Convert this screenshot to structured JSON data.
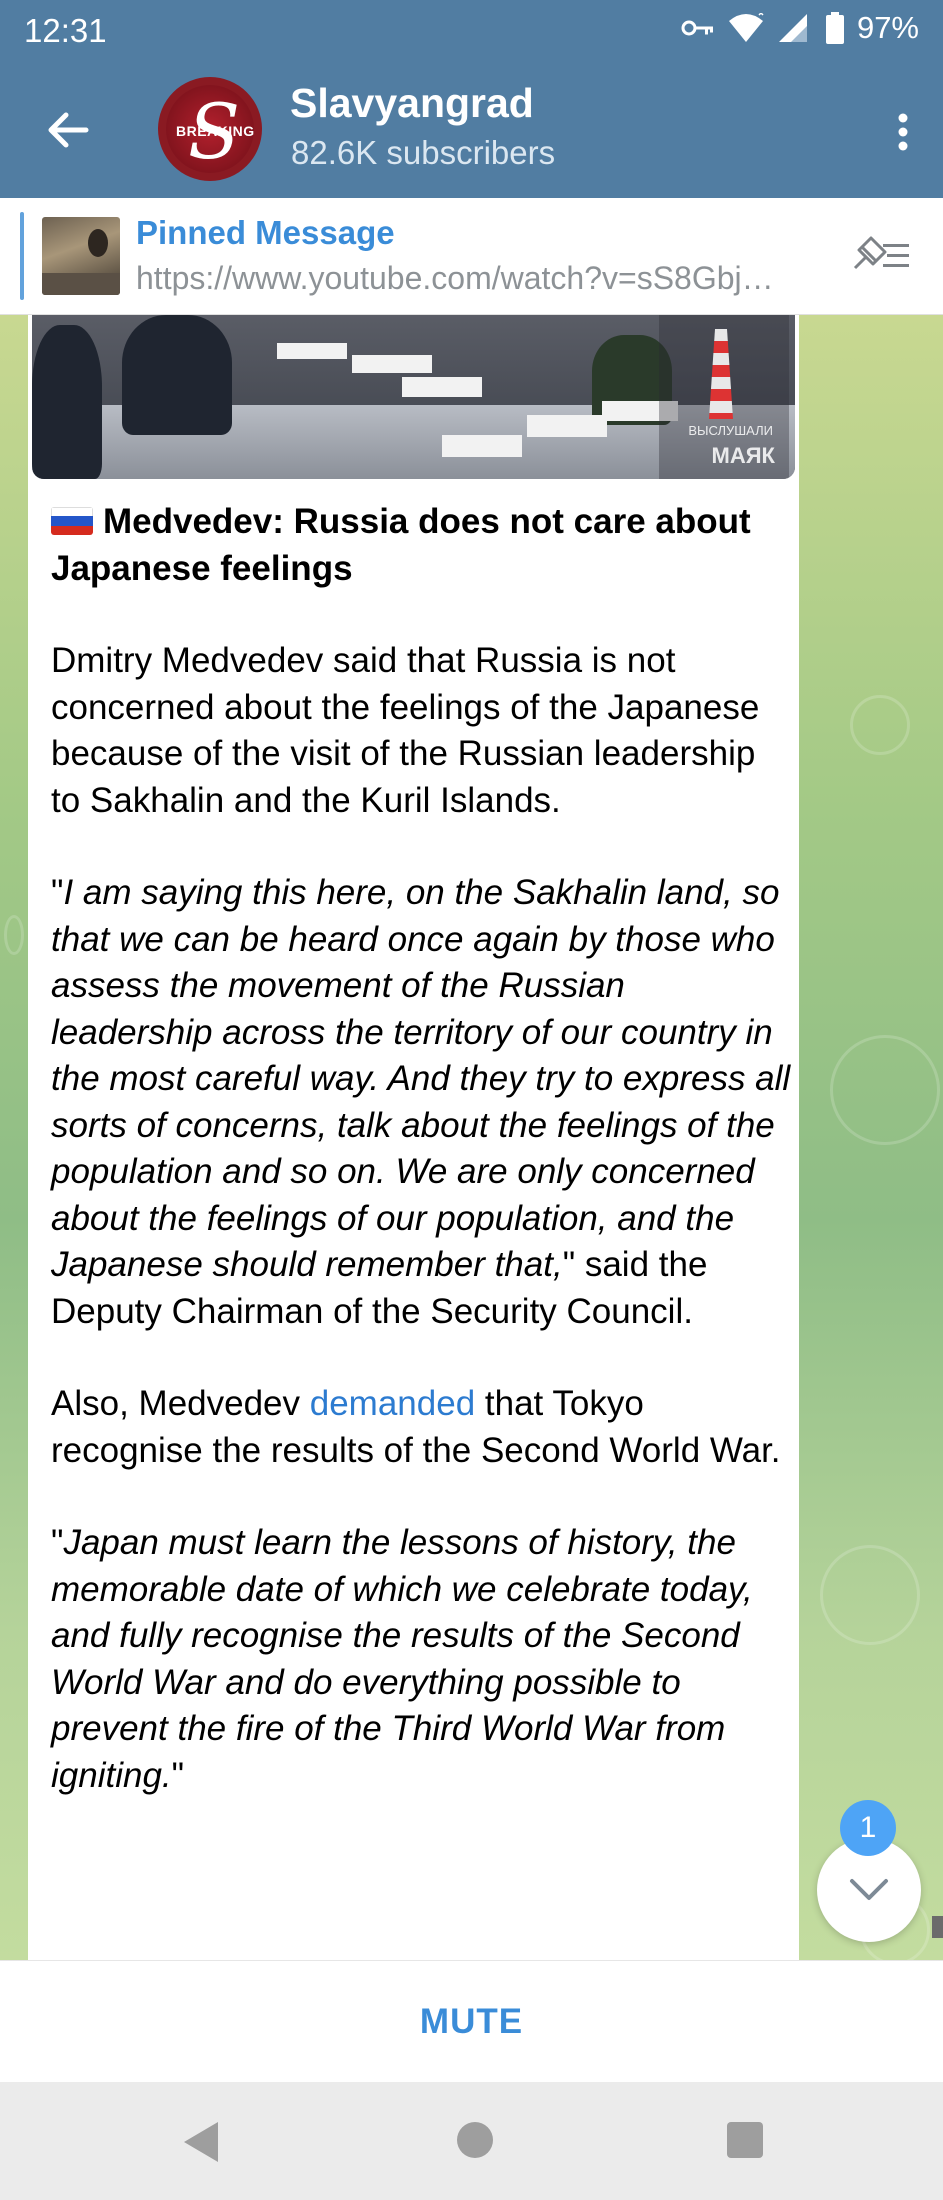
{
  "status_bar": {
    "time": "12:31",
    "battery": "97%",
    "icons": [
      "vpn-key-icon",
      "wifi-icon",
      "signal-icon",
      "battery-icon"
    ]
  },
  "header": {
    "channel_name": "Slavyangrad",
    "subscribers": "82.6K subscribers",
    "avatar_text": "BREAKING",
    "avatar_letter": "S"
  },
  "pinned": {
    "title": "Pinned Message",
    "url": "https://www.youtube.com/watch?v=sS8Gbj…"
  },
  "message": {
    "photo_watermark_small": "ВЫСЛУШАЛИ",
    "photo_watermark": "МАЯК",
    "title": "Medvedev: Russia does not care about Japanese feelings",
    "para1": "Dmitry Medvedev said that Russia is not concerned about the feelings of the Japanese because of the visit of the Russian leadership to Sakhalin and the Kuril Islands.",
    "quote1_open": "\"",
    "quote1": "I am saying this here, on the Sakhalin land, so that we can be heard once again by those who assess the movement of the Russian leadership across the territory of our country in the most careful way. And they try to express all sorts of concerns, talk about the feelings of the population and so on. We are only concerned about the feelings of our population, and the Japanese should remember that,",
    "quote1_after": "\" said the Deputy Chairman of the Security Council.",
    "para3_before": "Also, Medvedev ",
    "para3_link": "demanded",
    "para3_after": " that Tokyo recognise the results of the Second World War.",
    "quote2_open": "\"",
    "quote2": "Japan must learn the lessons of history, the memorable date of which we celebrate today, and fully recognise the results of the Second World War and do everything possible to prevent the fire of the Third World War from igniting.",
    "quote2_close": "\""
  },
  "scroll": {
    "unread_count": "1"
  },
  "bottom": {
    "mute_label": "MUTE"
  },
  "colors": {
    "header": "#517da2",
    "accent": "#3a8cd8",
    "link": "#2c7bd0",
    "badge": "#4ea4f6"
  }
}
